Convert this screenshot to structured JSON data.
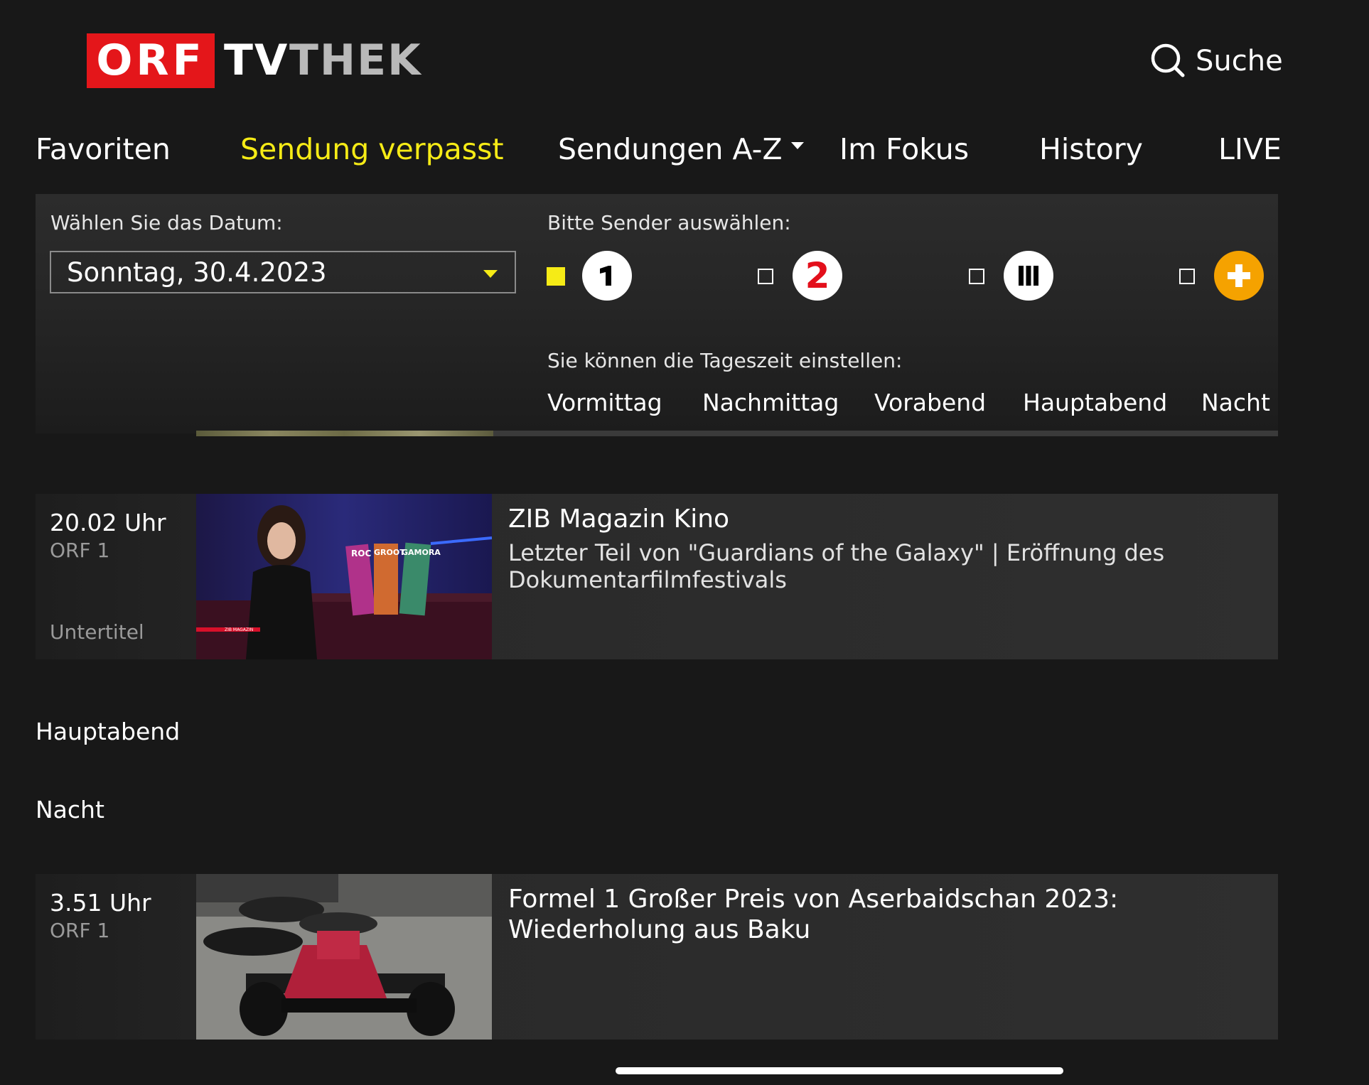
{
  "header": {
    "logo_orf": "ORF",
    "logo_tv": "TV",
    "logo_thek": "THEK",
    "search_label": "Suche"
  },
  "nav": {
    "favoriten": "Favoriten",
    "sendung_verpasst": "Sendung verpasst",
    "sendungen_az": "Sendungen A-Z",
    "im_fokus": "Im Fokus",
    "history": "History",
    "live": "LIVE",
    "active": "Sendung verpasst",
    "active_color": "#f6eb16"
  },
  "filters": {
    "date_label": "Wählen Sie das Datum:",
    "date_value": "Sonntag, 30.4.2023",
    "channel_label": "Bitte Sender auswählen:",
    "channels": [
      {
        "name": "ORF 1",
        "glyph": "1",
        "selected": true
      },
      {
        "name": "ORF 2",
        "glyph": "2",
        "selected": false
      },
      {
        "name": "ORF III",
        "glyph": "III",
        "selected": false
      },
      {
        "name": "ORF SPORT +",
        "glyph": "+",
        "selected": false
      }
    ],
    "timeofday_label": "Sie können die Tageszeit einstellen:",
    "timeofday": [
      "Vormittag",
      "Nachmittag",
      "Vorabend",
      "Hauptabend",
      "Nacht"
    ]
  },
  "listings": [
    {
      "time": "20.02 Uhr",
      "channel": "ORF 1",
      "flag": "Untertitel",
      "title": "ZIB Magazin Kino",
      "description": "Letzter Teil von \"Guardians of the Galaxy\" | Eröffnung des Dokumentarfilmfestivals",
      "thumb_label": "ZIB MAGAZIN",
      "thumb_poster_texts": [
        "ROC",
        "GROOT",
        "GAMORA"
      ]
    },
    {
      "time": "3.51 Uhr",
      "channel": "ORF 1",
      "title": "Formel 1 Großer Preis von Aserbaidschan 2023: Wiederholung aus Baku"
    }
  ],
  "sections": {
    "hauptabend": "Hauptabend",
    "nacht": "Nacht"
  },
  "colors": {
    "orf_red": "#e4161a",
    "accent_yellow": "#f6eb16",
    "orf2_red": "#e30f1b",
    "sport_orange": "#f5a200",
    "background": "#181818"
  }
}
